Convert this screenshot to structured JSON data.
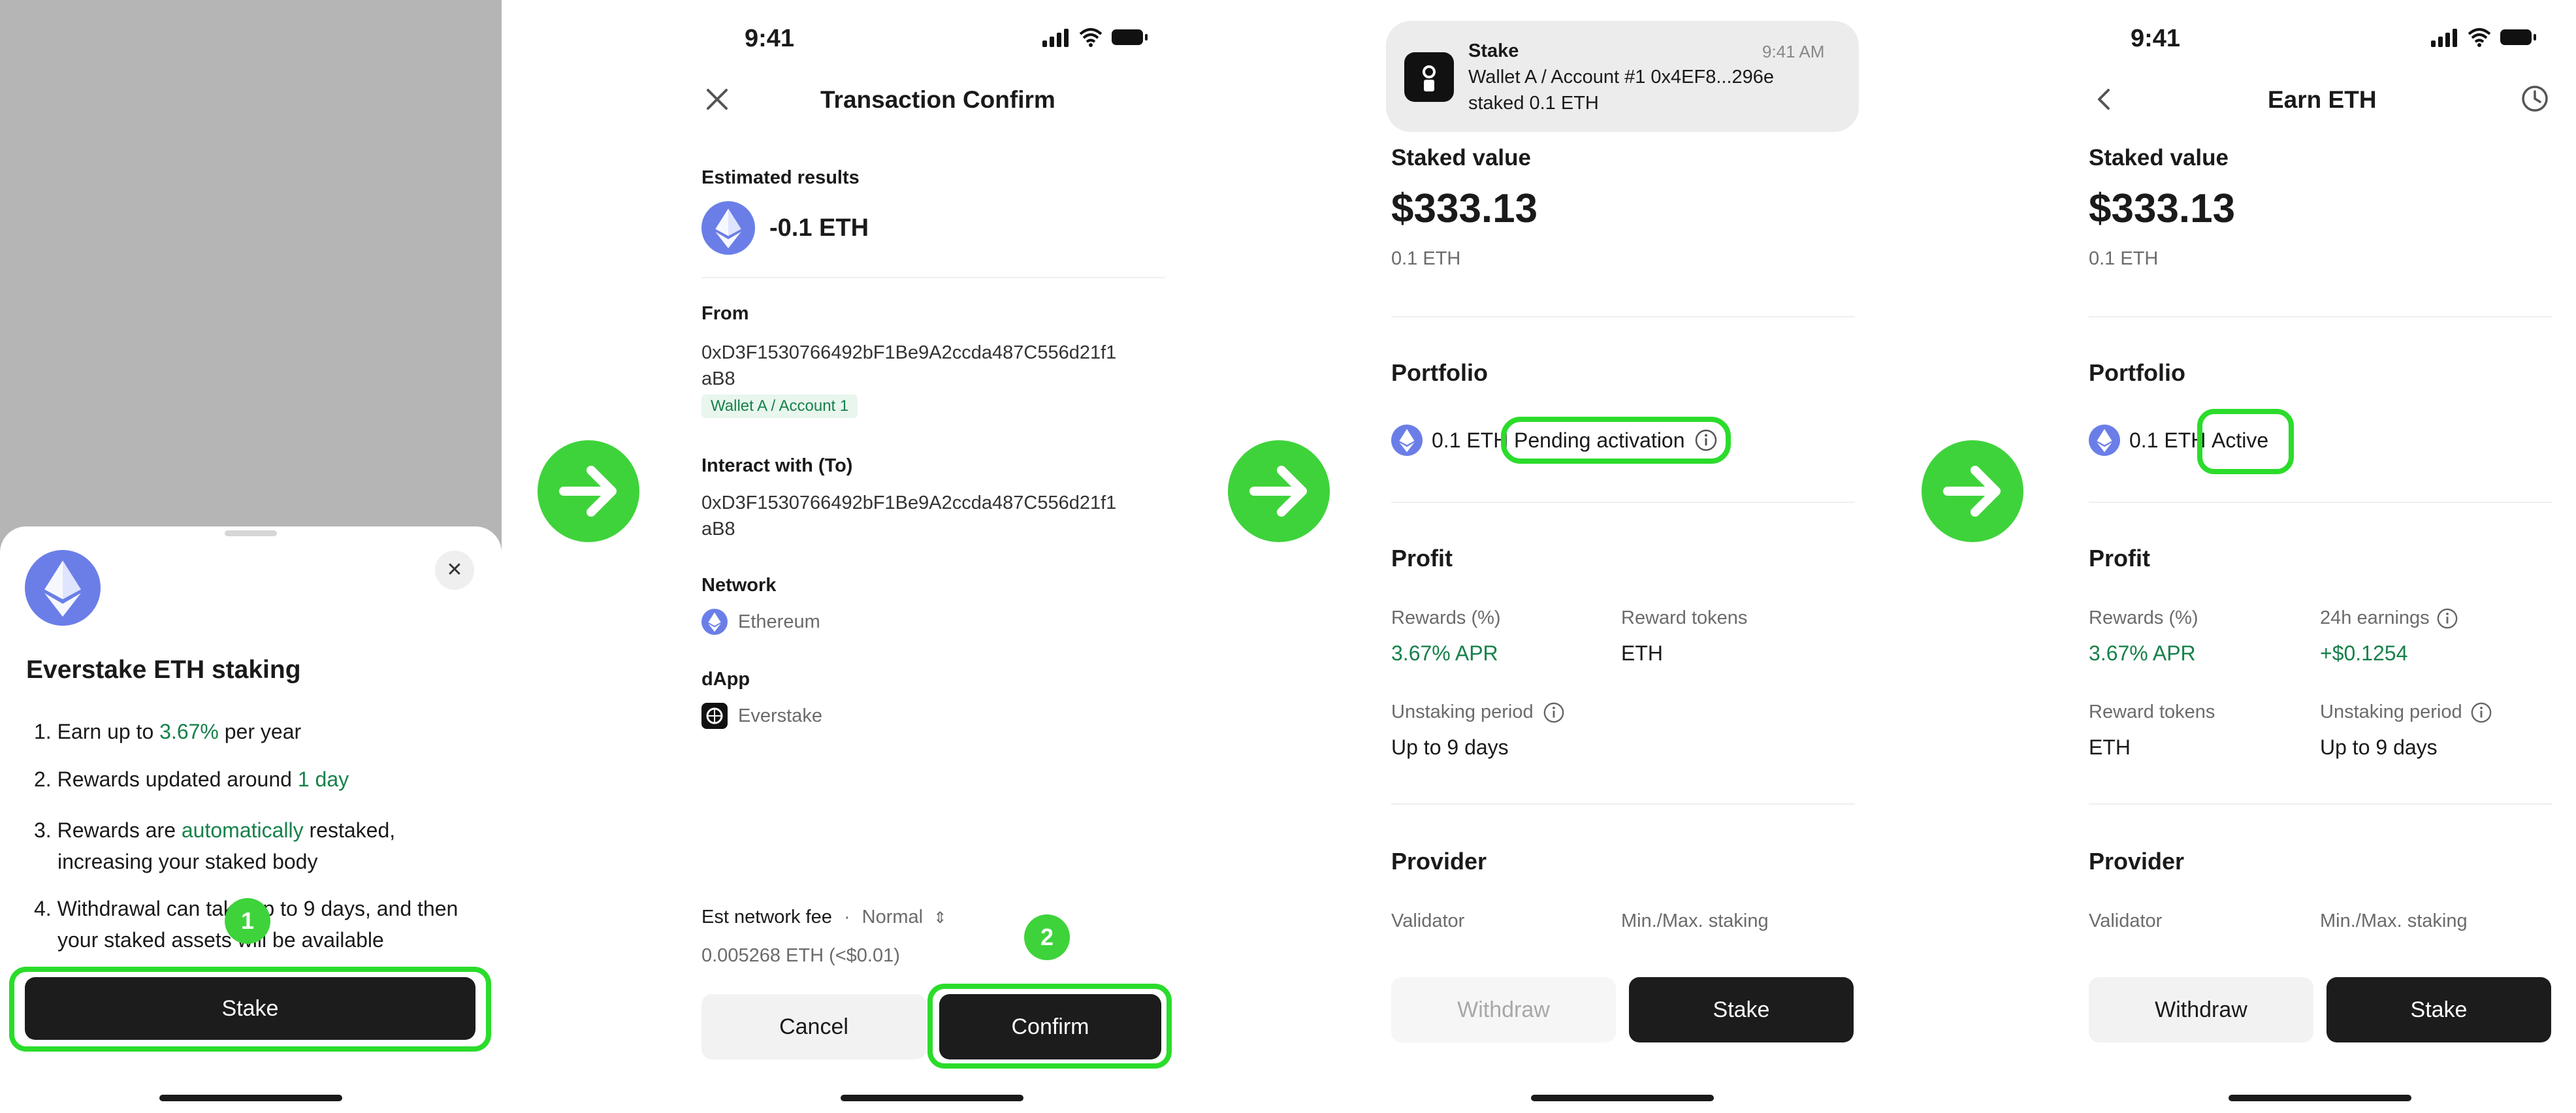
{
  "status_time": "9:41",
  "sheet": {
    "title": "Everstake ETH staking",
    "items": [
      {
        "num": "1.",
        "a": "Earn up to ",
        "hl": "3.67%",
        "b": " per year"
      },
      {
        "num": "2.",
        "a": "Rewards updated around ",
        "hl": "1 day",
        "b": ""
      },
      {
        "num": "3.",
        "a": "Rewards are ",
        "hl": "automatically",
        "b": " restaked,",
        "line2": "increasing your staked body"
      },
      {
        "num": "4.",
        "a": "Withdrawal can take up to 9 days, and then",
        "line2": "your staked assets will be available"
      }
    ],
    "stake_label": "Stake",
    "step_badge": "1"
  },
  "confirm": {
    "title": "Transaction Confirm",
    "estimated_label": "Estimated results",
    "estimated_value": "-0.1 ETH",
    "from_label": "From",
    "from_addr_l1": "0xD3F1530766492bF1Be9A2ccda487C556d21f1",
    "from_addr_l2": "aB8",
    "wallet_tag": "Wallet A / Account 1",
    "to_label": "Interact with (To)",
    "to_addr_l1": "0xD3F1530766492bF1Be9A2ccda487C556d21f1",
    "to_addr_l2": "aB8",
    "network_label": "Network",
    "network_value": "Ethereum",
    "dapp_label": "dApp",
    "dapp_value": "Everstake",
    "fee_label": "Est network fee",
    "fee_dot": "·",
    "fee_speed": "Normal",
    "fee_value": "0.005268 ETH (<$0.01)",
    "cancel_label": "Cancel",
    "confirm_label": "Confirm",
    "step_badge": "2"
  },
  "pending": {
    "notif_app": "Stake",
    "notif_time": "9:41 AM",
    "notif_line1": "Wallet A / Account #1 0x4EF8...296e",
    "notif_line2": "staked 0.1 ETH",
    "staked_label": "Staked value",
    "staked_usd": "$333.13",
    "staked_eth": "0.1 ETH",
    "portfolio_label": "Portfolio",
    "portfolio_amount": "0.1 ETH",
    "status": "Pending activation",
    "profit_label": "Profit",
    "rewards_label": "Rewards (%)",
    "rewards_value": "3.67% APR",
    "reward_tokens_label": "Reward tokens",
    "reward_tokens_value": "ETH",
    "unstaking_label": "Unstaking period",
    "unstaking_value": "Up to 9 days",
    "provider_label": "Provider",
    "validator_label": "Validator",
    "minmax_label": "Min./Max. staking",
    "withdraw_label": "Withdraw",
    "stake_label": "Stake"
  },
  "active": {
    "title": "Earn ETH",
    "staked_label": "Staked value",
    "staked_usd": "$333.13",
    "staked_eth": "0.1 ETH",
    "portfolio_label": "Portfolio",
    "portfolio_amount": "0.1 ETH",
    "status": "Active",
    "profit_label": "Profit",
    "rewards_label": "Rewards (%)",
    "rewards_value": "3.67% APR",
    "earnings_label": "24h earnings",
    "earnings_value": "+$0.1254",
    "reward_tokens_label": "Reward tokens",
    "reward_tokens_value": "ETH",
    "unstaking_label": "Unstaking period",
    "unstaking_value": "Up to 9 days",
    "provider_label": "Provider",
    "validator_label": "Validator",
    "minmax_label": "Min./Max. staking",
    "withdraw_label": "Withdraw",
    "stake_label": "Stake"
  },
  "colors": {
    "accent_green": "#3ed33b",
    "highlight_green": "#2bdc2b",
    "text_green": "#17814a",
    "eth_blue": "#6b7ee8",
    "dark_button": "#1c1c1c"
  }
}
